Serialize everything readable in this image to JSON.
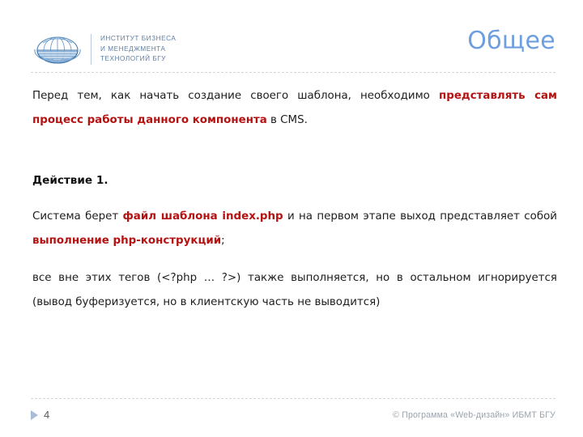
{
  "header": {
    "logo": {
      "icon": "globe-logo-icon",
      "lines": [
        "ИНСТИТУТ БИЗНЕСА",
        "И МЕНЕДЖМЕНТА",
        "ТЕХНОЛОГИЙ БГУ"
      ]
    },
    "title": "Общее",
    "title_color": "#6c9ee0"
  },
  "content": {
    "intro": {
      "before": "Перед тем, как начать создание своего шаблона, необходимо ",
      "emphasis": "представлять сам процесс работы данного компонента",
      "after": " в CMS."
    },
    "step_heading": "Действие 1.",
    "step_body": {
      "part1": "Система берет ",
      "emphasis1": "файл шаблона index.php",
      "part2": " и на первом этапе выход представляет собой ",
      "emphasis2": "выполнение php-конструкций",
      "part3": ";"
    },
    "note": "все вне этих тегов (<?php … ?>) также выполняется, но в остальном игнорируется (вывод буферизуется, но в клиентскую часть не выводится)",
    "emphasis_color": "#b51212"
  },
  "footer": {
    "marker_icon": "triangle-right-icon",
    "slide_number": "4",
    "copyright": "© Программа «Web-дизайн» ИБМТ БГУ"
  }
}
